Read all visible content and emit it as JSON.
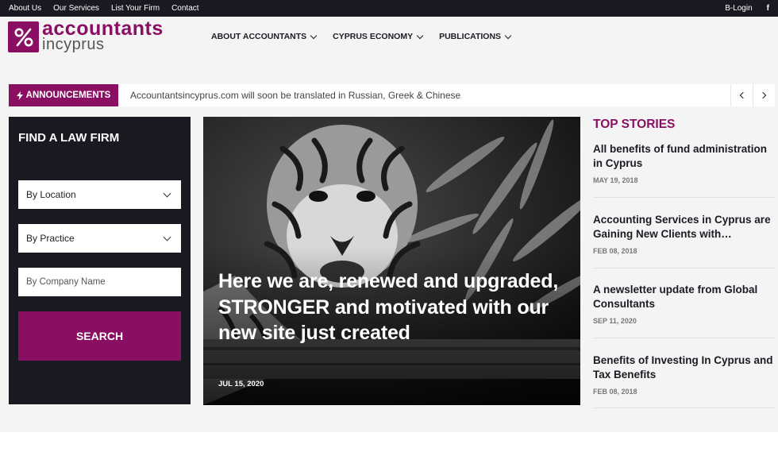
{
  "topbar": {
    "links": [
      "About Us",
      "Our Services",
      "List Your Firm",
      "Contact"
    ],
    "login": "B-Login",
    "facebook_icon": "f"
  },
  "logo": {
    "mark": "%",
    "line1": "accountants",
    "line2": "incyprus"
  },
  "nav": {
    "items": [
      "ABOUT ACCOUNTANTS",
      "CYPRUS ECONOMY",
      "PUBLICATIONS"
    ]
  },
  "announcements": {
    "label": "ANNOUNCEMENTS",
    "text": "Accountantsincyprus.com will soon be translated in Russian, Greek & Chinese"
  },
  "law_firm": {
    "title": "FIND A LAW FIRM",
    "location": "By Location",
    "practice": "By Practice",
    "company_placeholder": "By Company Name",
    "search": "SEARCH"
  },
  "feature": {
    "headline": "Here we are, renewed and upgraded, STRONGER and motivated with our new site just created",
    "date": "JUL 15, 2020"
  },
  "top_stories": {
    "title": "TOP STORIES",
    "items": [
      {
        "title": "All benefits of fund administration in Cyprus",
        "date": "MAY 19, 2018"
      },
      {
        "title": "Accounting Services in Cyprus are Gaining New Clients with…",
        "date": "FEB 08, 2018"
      },
      {
        "title": "A newsletter update from Global Consultants",
        "date": "SEP 11, 2020"
      },
      {
        "title": "Benefits of Investing In Cyprus and Tax Benefits",
        "date": "FEB 08, 2018"
      }
    ]
  },
  "colors": {
    "brand": "#8a0f63",
    "dark": "#191922"
  }
}
